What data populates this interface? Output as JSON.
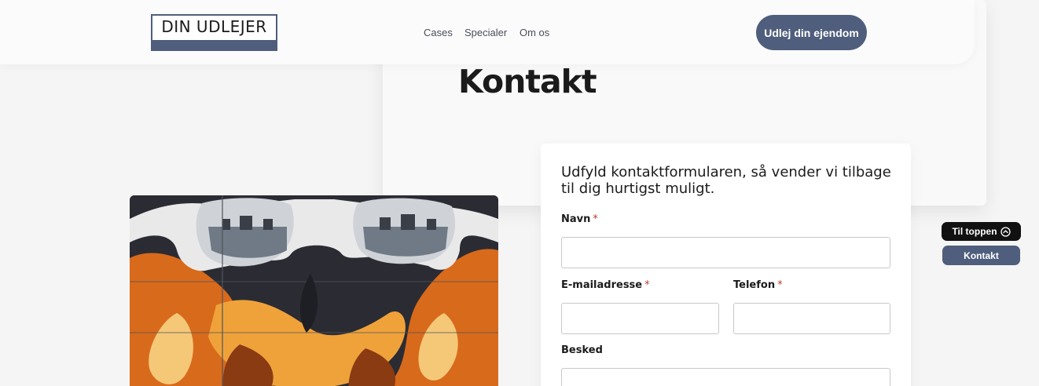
{
  "header": {
    "logo_text": "DIN UDLEJER",
    "nav": [
      "Cases",
      "Specialer",
      "Om os"
    ],
    "cta_label": "Udlej din ejendom"
  },
  "main": {
    "title": "Kontakt",
    "form": {
      "intro": "Udfyld kontaktformularen, så vender vi tilbage til dig hurtigst muligt.",
      "name_label": "Navn",
      "email_label": "E-mailadresse",
      "phone_label": "Telefon",
      "message_label": "Besked",
      "required_marker": "*",
      "name_value": "",
      "email_value": "",
      "phone_value": "",
      "message_value": ""
    }
  },
  "floating": {
    "to_top_label": "Til toppen",
    "to_top_icon": "chevron-up-circle-icon",
    "contact_label": "Kontakt"
  },
  "colors": {
    "brand": "#4f5e7c",
    "background": "#f5f5f5",
    "required": "#c0392b"
  }
}
